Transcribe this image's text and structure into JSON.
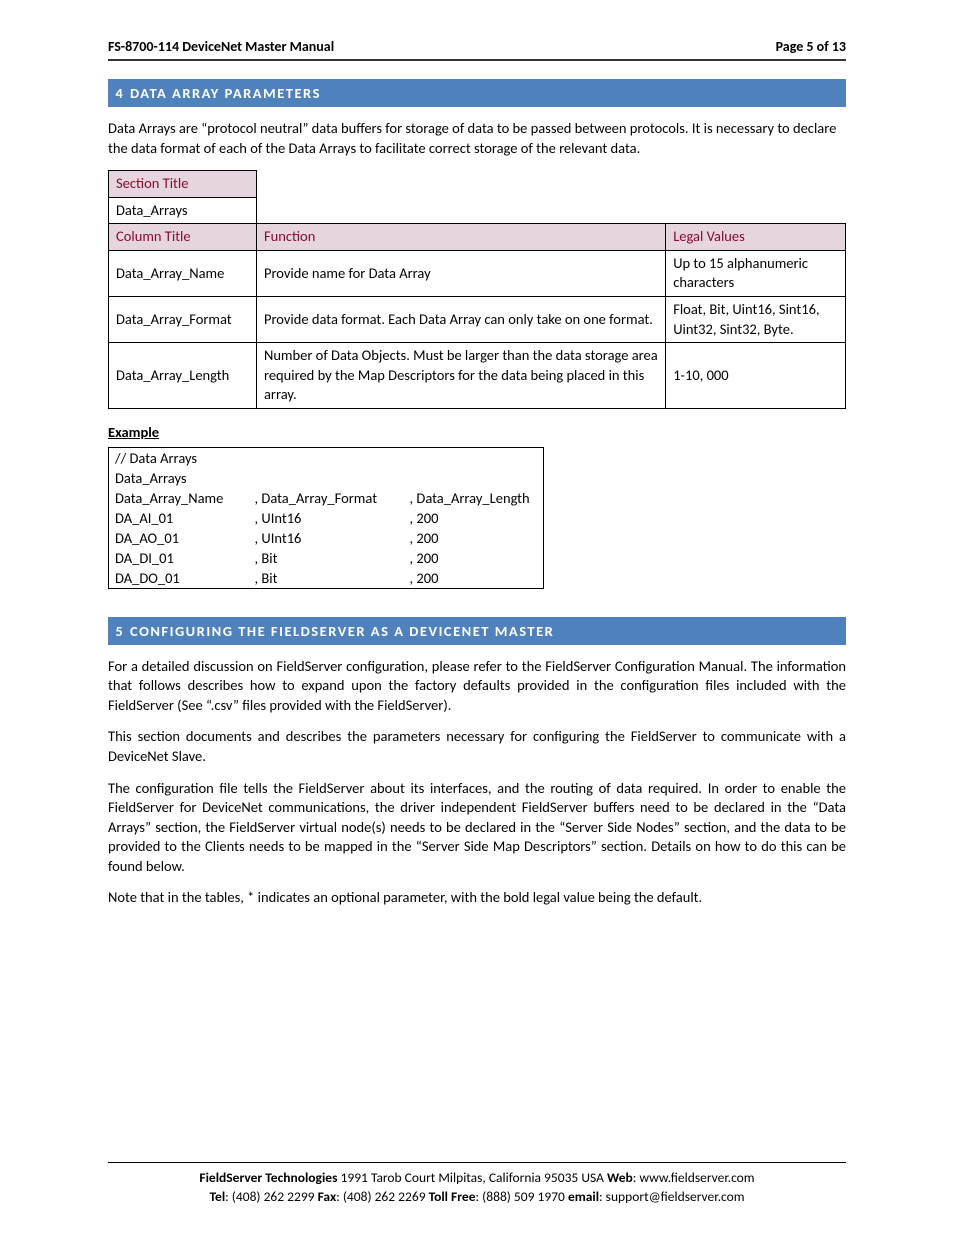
{
  "header": {
    "title": "FS-8700-114 DeviceNet Master Manual",
    "page": "Page 5 of 13"
  },
  "section4": {
    "num": "4",
    "title": "DATA ARRAY PARAMETERS",
    "intro": "Data Arrays are “protocol neutral” data buffers for storage of data to be passed between protocols.  It is necessary to declare the data format of each of the Data Arrays to facilitate correct storage of the relevant data."
  },
  "paramTable": {
    "h_sectionTitle": "Section Title",
    "h_dataArrays": "Data_Arrays",
    "h_columnTitle": "Column Title",
    "h_function": "Function",
    "h_legal": "Legal Values",
    "rows": [
      {
        "name": "Data_Array_Name",
        "func": "Provide name for Data Array",
        "legal": "Up to 15 alphanumeric characters"
      },
      {
        "name": "Data_Array_Format",
        "func": "Provide data format. Each Data Array can only take on one format.",
        "legal": "Float, Bit, Uint16, Sint16, Uint32, Sint32, Byte."
      },
      {
        "name": "Data_Array_Length",
        "func": "Number of Data Objects. Must be larger than the data storage area required by the Map Descriptors for the data being placed in this array.",
        "legal": "1-10, 000"
      }
    ]
  },
  "exampleLabel": "Example",
  "exampleTable": {
    "comment": "//    Data Arrays",
    "section": "Data_Arrays",
    "headers": [
      "Data_Array_Name",
      ", Data_Array_Format",
      ", Data_Array_Length"
    ],
    "rows": [
      [
        "DA_AI_01",
        ", UInt16",
        ", 200"
      ],
      [
        "DA_AO_01",
        ", UInt16",
        ", 200"
      ],
      [
        "DA_DI_01",
        ", Bit",
        ", 200"
      ],
      [
        "DA_DO_01",
        ", Bit",
        ", 200"
      ]
    ]
  },
  "section5": {
    "num": "5",
    "title": "CONFIGURING THE FIELDSERVER AS A DEVICENET MASTER",
    "p1": "For a detailed discussion on FieldServer configuration, please refer to the FieldServer Configuration Manual.  The information that follows describes how to expand upon the factory defaults provided in the configuration files included with the FieldServer (See “.csv” files provided with the FieldServer).",
    "p2": "This section documents and describes the parameters necessary for configuring the FieldServer to communicate with a DeviceNet Slave.",
    "p3": "The configuration file tells the FieldServer about its interfaces, and the routing of data required.  In order to enable the FieldServer for DeviceNet communications, the driver independent FieldServer buffers need to be declared in the “Data Arrays” section, the FieldServer virtual node(s) needs to be declared in the “Server Side Nodes” section, and the data to be provided to the Clients needs to be mapped in the “Server Side Map Descriptors” section.  Details on how to do this can be found below.",
    "p4": "Note that in the tables, * indicates an optional parameter, with the bold legal value being the default."
  },
  "footer": {
    "company": "FieldServer Technologies",
    "addr": " 1991 Tarob Court Milpitas, California 95035 USA   ",
    "webLbl": "Web",
    "web": ": www.fieldserver.com",
    "telLbl": "Tel",
    "tel": ": (408) 262 2299   ",
    "faxLbl": "Fax",
    "fax": ": (408) 262 2269   ",
    "tollLbl": "Toll Free",
    "toll": ": (888) 509 1970   ",
    "emailLbl": "email",
    "email": ": support@fieldserver.com"
  }
}
